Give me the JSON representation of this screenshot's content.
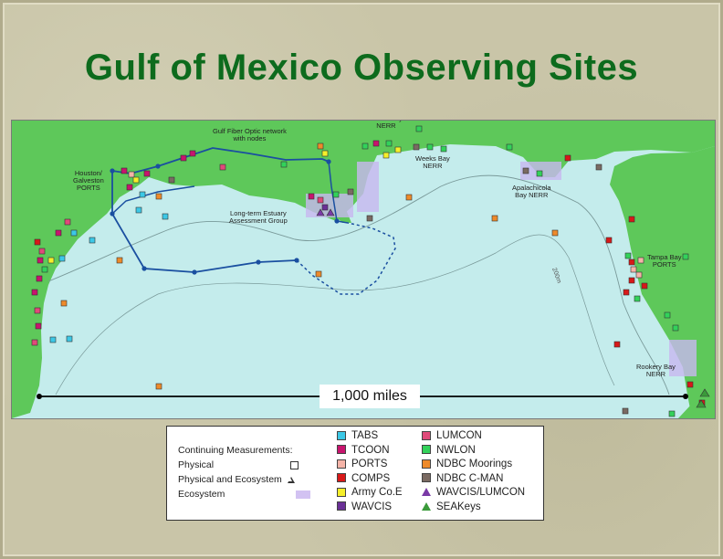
{
  "title": "Gulf of Mexico Observing Sites",
  "map": {
    "labels": {
      "grand_bay": "Grand Bay\nNERR",
      "fiber": "Gulf Fiber Optic network\nwith nodes",
      "houston": "Houston/\nGalveston\nPORTS",
      "weeks_bay": "Weeks Bay\nNERR",
      "apalachicola": "Apalachicola\nBay NERR",
      "estuary": "Long-term Estuary\nAssessment Group",
      "tampa": "Tampa Bay\nPORTS",
      "rookery": "Rookery Bay\nNERR",
      "contour": "200m"
    },
    "scale_label": "1,000 miles",
    "colors": {
      "land": "#5ec85a",
      "water": "#c4ecec",
      "network": "#1a4fa0",
      "ecosystem": "#c8b8f0"
    }
  },
  "legend": {
    "continuing": "Continuing Measurements:",
    "physical": "Physical",
    "phys_eco": "Physical and Ecosystem",
    "ecosystem": "Ecosystem",
    "col1": [
      {
        "label": "TABS",
        "color": "#3cc8e6"
      },
      {
        "label": "TCOON",
        "color": "#c8146e"
      },
      {
        "label": "PORTS",
        "color": "#f5b4a8"
      },
      {
        "label": "COMPS",
        "color": "#d81818"
      },
      {
        "label": "Army Co.E",
        "color": "#f5ef2a"
      },
      {
        "label": "WAVCIS",
        "color": "#6a3096"
      }
    ],
    "col2": [
      {
        "label": "LUMCON",
        "color": "#e04a7a",
        "shape": "square"
      },
      {
        "label": "NWLON",
        "color": "#32d25a",
        "shape": "square"
      },
      {
        "label": "NDBC Moorings",
        "color": "#ee8a2a",
        "shape": "square"
      },
      {
        "label": "NDBC C-MAN",
        "color": "#7a6a62",
        "shape": "square"
      },
      {
        "label": "WAVCIS/LUMCON",
        "color": "#7a3aa6",
        "shape": "triangle"
      },
      {
        "label": "SEAKeys",
        "color": "#3a9a3a",
        "shape": "triangle"
      }
    ]
  }
}
